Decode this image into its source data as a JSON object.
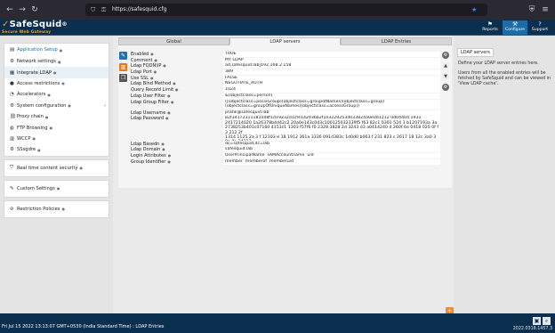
{
  "browser": {
    "url": "https://safesquid.cfg"
  },
  "header": {
    "logo_text": "SafeSquid",
    "logo_reg": "®",
    "logo_tagline": "Secure Web Gateway",
    "nav": [
      {
        "label": "Reports",
        "icon": "reports-icon"
      },
      {
        "label": "Configure",
        "icon": "configure-icon"
      },
      {
        "label": "Support",
        "icon": "support-icon"
      }
    ]
  },
  "sidebar": {
    "application_setup": "Application Setup",
    "items": [
      "Network settings",
      "Integrate LDAP",
      "Access restrictions",
      "Accelerators",
      "System configuration",
      "Proxy chain",
      "FTP Browsing",
      "WCCP",
      "SSsgdre"
    ],
    "realtime": "Real time content security",
    "custom": "Custom Settings",
    "restriction": "Restriction Policies"
  },
  "tabs": [
    "Global",
    "LDAP servers",
    "LDAP Entries"
  ],
  "active_tab": 1,
  "fields": [
    {
      "label": "Enabled",
      "value": "TRUE"
    },
    {
      "label": "Comment",
      "value": "MY LDAP"
    },
    {
      "label": "Ldap FQDN\\IP",
      "value": "ad.safesquid.lab|192.168.2.158"
    },
    {
      "label": "Ldap Port",
      "value": "389"
    },
    {
      "label": "Use SSL",
      "value": "FALSE"
    },
    {
      "label": "Ldap Bind Method",
      "value": "NEGOTIATE_AUTH"
    },
    {
      "label": "Query Record Limit",
      "value": "1024"
    },
    {
      "label": "Ldap User Filter",
      "value": "&(objectclass=person)"
    },
    {
      "label": "Ldap Group Filter",
      "value": "(|(objectclass=posixGroup)(objectclass=groupofNames)(objectclass=group)\n(objectclass=groupOfUniqueNames)(objectclass=accessGroup))"
    },
    {
      "label": "Ldap Username",
      "value": "pratik@safesquid.lab"
    },
    {
      "label": "Ldap Password",
      "value": "82f34172311181048f1d19232d1cfe142936b2f1e32292534033824a0e0d1212 0d04404 1931\n2417214020 1a26378b4d42c2 20a0e143c0d3c100125032339f5 f63 82c1 0301 524 3 b1207193a 3a\n2738253b401c07160 4153c1 1303 f57f6 f0 2328 3828 2d 3243 d3 a0414240 4 260f 6e 0418 025 0f f 3 212 2f\n1314 1125 2a 3 f 12103 e 18 1912 361a 3336 091d383c 1d0d0 b063 f 231 823 c 2617 18 12c 3a0 3 0a 0e 24122\n8233a54 0 2013a 361 6 5 3 0 8 4 0 3 4 1941"
    },
    {
      "label": "Ldap Basedn",
      "value": "dc=safesquid,dc=lab"
    },
    {
      "label": "Ldap Domain",
      "value": "safesquid.lab"
    },
    {
      "label": "Login Attributes",
      "value": "UserPrincipalName  sAMAccountname  uid"
    },
    {
      "label": "Group Identifier",
      "value": "member  memberof  memberuid"
    }
  ],
  "right": {
    "title": "LDAP servers",
    "p1": "Define your LDAP server entries here.",
    "p2": "Users from all the enabled entries will be fetched by SafeSquid and can be viewed in 'View LDAP cache'."
  },
  "status": {
    "text": "Fri Jul 15 2022 13:13:07 GMT+0530 (India Standard Time) : LDAP Entries",
    "version": "2022.0318.1457.3"
  }
}
